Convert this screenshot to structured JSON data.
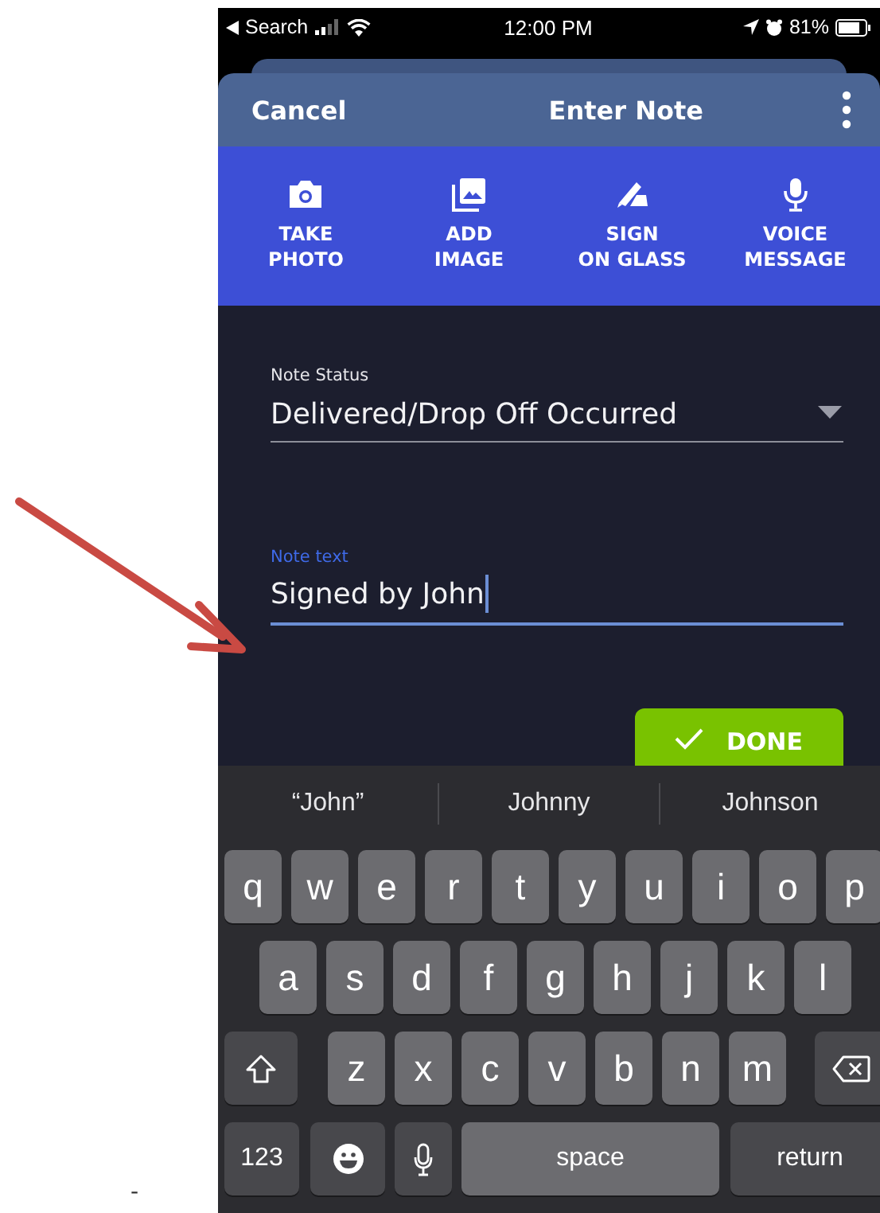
{
  "status_bar": {
    "back_label": "Search",
    "time": "12:00 PM",
    "battery": "81%"
  },
  "header": {
    "cancel": "Cancel",
    "title": "Enter Note"
  },
  "actions": [
    {
      "kind": "camera",
      "lines": [
        "TAKE",
        "PHOTO"
      ]
    },
    {
      "kind": "gallery",
      "lines": [
        "ADD",
        "IMAGE"
      ]
    },
    {
      "kind": "sign",
      "lines": [
        "SIGN",
        "ON GLASS"
      ]
    },
    {
      "kind": "mic",
      "lines": [
        "VOICE",
        "MESSAGE"
      ]
    }
  ],
  "note_status": {
    "label": "Note Status",
    "value": "Delivered/Drop Off Occurred"
  },
  "note_text": {
    "label": "Note text",
    "value": "Signed by John",
    "focused": true
  },
  "done_button": "DONE",
  "keyboard": {
    "suggestions": [
      "“John”",
      "Johnny",
      "Johnson"
    ],
    "key_rows": [
      {
        "keys": [
          {
            "kind": "letter",
            "label": "q"
          },
          {
            "kind": "letter",
            "label": "w"
          },
          {
            "kind": "letter",
            "label": "e"
          },
          {
            "kind": "letter",
            "label": "r"
          },
          {
            "kind": "letter",
            "label": "t"
          },
          {
            "kind": "letter",
            "label": "y"
          },
          {
            "kind": "letter",
            "label": "u"
          },
          {
            "kind": "letter",
            "label": "i"
          },
          {
            "kind": "letter",
            "label": "o"
          },
          {
            "kind": "letter",
            "label": "p"
          }
        ]
      },
      {
        "keys": [
          {
            "kind": "letter",
            "label": "a"
          },
          {
            "kind": "letter",
            "label": "s"
          },
          {
            "kind": "letter",
            "label": "d"
          },
          {
            "kind": "letter",
            "label": "f"
          },
          {
            "kind": "letter",
            "label": "g"
          },
          {
            "kind": "letter",
            "label": "h"
          },
          {
            "kind": "letter",
            "label": "j"
          },
          {
            "kind": "letter",
            "label": "k"
          },
          {
            "kind": "letter",
            "label": "l"
          }
        ]
      },
      {
        "keys": [
          {
            "kind": "shift"
          },
          {
            "kind": "letter",
            "label": "z"
          },
          {
            "kind": "letter",
            "label": "x"
          },
          {
            "kind": "letter",
            "label": "c"
          },
          {
            "kind": "letter",
            "label": "v"
          },
          {
            "kind": "letter",
            "label": "b"
          },
          {
            "kind": "letter",
            "label": "n"
          },
          {
            "kind": "letter",
            "label": "m"
          },
          {
            "kind": "delete"
          }
        ]
      },
      {
        "keys": [
          {
            "kind": "numbers",
            "label": "123"
          },
          {
            "kind": "emoji"
          },
          {
            "kind": "mic"
          },
          {
            "kind": "space",
            "label": "space"
          },
          {
            "kind": "return",
            "label": "return"
          }
        ]
      }
    ]
  },
  "stray_mark": "-"
}
